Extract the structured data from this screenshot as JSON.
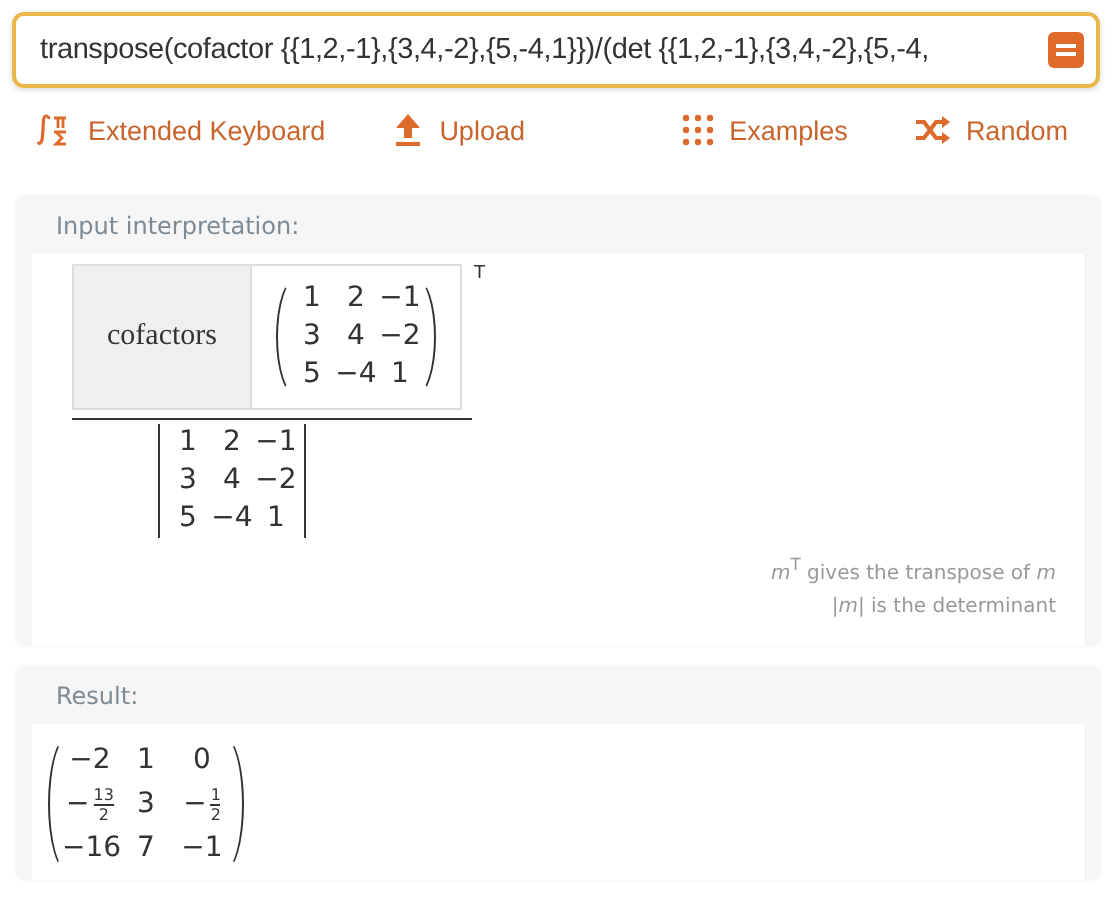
{
  "query": {
    "value": "transpose(cofactor {{1,2,-1},{3,4,-2},{5,-4,1}})/(det  {{1,2,-1},{3,4,-2},{5,-4,"
  },
  "toolbar": [
    {
      "kind": "keyboard",
      "label": "Extended Keyboard"
    },
    {
      "kind": "upload",
      "label": "Upload"
    },
    {
      "kind": "examples",
      "label": "Examples"
    },
    {
      "kind": "random",
      "label": "Random"
    }
  ],
  "input_interpretation": {
    "title": "Input interpretation:",
    "label": "cofactors",
    "superscript": "T",
    "matrix": [
      [
        "1",
        "2",
        "−1"
      ],
      [
        "3",
        "4",
        "−2"
      ],
      [
        "5",
        "−4",
        "1"
      ]
    ],
    "determinant": [
      [
        "1",
        "2",
        "−1"
      ],
      [
        "3",
        "4",
        "−2"
      ],
      [
        "5",
        "−4",
        "1"
      ]
    ],
    "notes": [
      "*m*$^{T}$ gives the transpose of *m*",
      "|*m*| is the determinant"
    ]
  },
  "result": {
    "title": "Result:",
    "matrix": [
      [
        {
          "kind": "number",
          "text": "−2"
        },
        {
          "kind": "number",
          "text": "1"
        },
        {
          "kind": "number",
          "text": "0"
        }
      ],
      [
        {
          "kind": "fraction",
          "sign": "−",
          "num": "13",
          "den": "2"
        },
        {
          "kind": "number",
          "text": "3"
        },
        {
          "kind": "fraction",
          "sign": "−",
          "num": "1",
          "den": "2"
        }
      ],
      [
        {
          "kind": "number",
          "text": "−16"
        },
        {
          "kind": "number",
          "text": "7"
        },
        {
          "kind": "number",
          "text": "−1"
        }
      ]
    ]
  }
}
